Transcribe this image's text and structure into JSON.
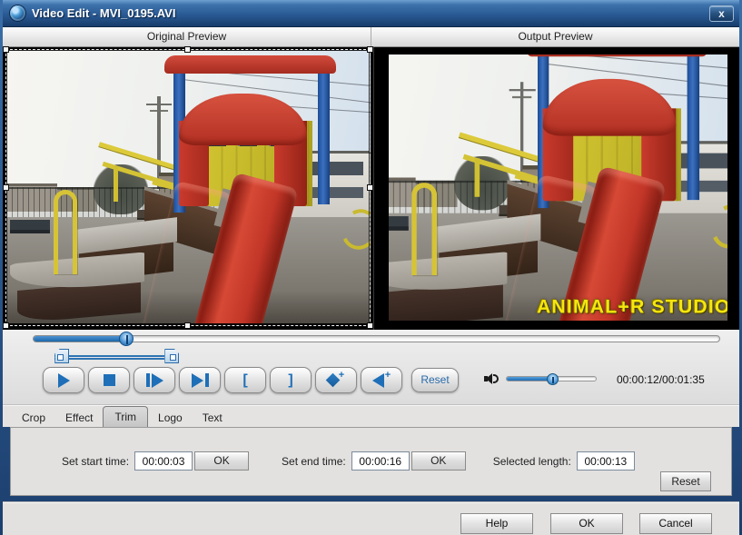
{
  "window": {
    "title": "Video Edit - MVI_0195.AVI",
    "close_glyph": "x"
  },
  "previews": {
    "original_label": "Original Preview",
    "output_label": "Output Preview",
    "watermark": "ANIMAL+R STUDIO"
  },
  "player": {
    "seek_pct": "13.5%",
    "trim_start_pct": "3.2%",
    "trim_end_pct": "19.2%",
    "trim_width_pct": "16.0%",
    "volume_pct": "52%",
    "time_display": "00:00:12/00:01:35",
    "reset_label": "Reset",
    "mark_in_glyph": "[",
    "mark_out_glyph": "]",
    "plus_glyph": "+"
  },
  "tabs": {
    "items": [
      {
        "label": "Crop"
      },
      {
        "label": "Effect"
      },
      {
        "label": "Trim"
      },
      {
        "label": "Logo"
      },
      {
        "label": "Text"
      }
    ]
  },
  "trim_panel": {
    "start_label": "Set start time:",
    "start_value": "00:00:03",
    "start_ok": "OK",
    "end_label": "Set end time:",
    "end_value": "00:00:16",
    "end_ok": "OK",
    "length_label": "Selected length:",
    "length_value": "00:00:13",
    "reset_label": "Reset"
  },
  "footer": {
    "help": "Help",
    "ok": "OK",
    "cancel": "Cancel"
  }
}
